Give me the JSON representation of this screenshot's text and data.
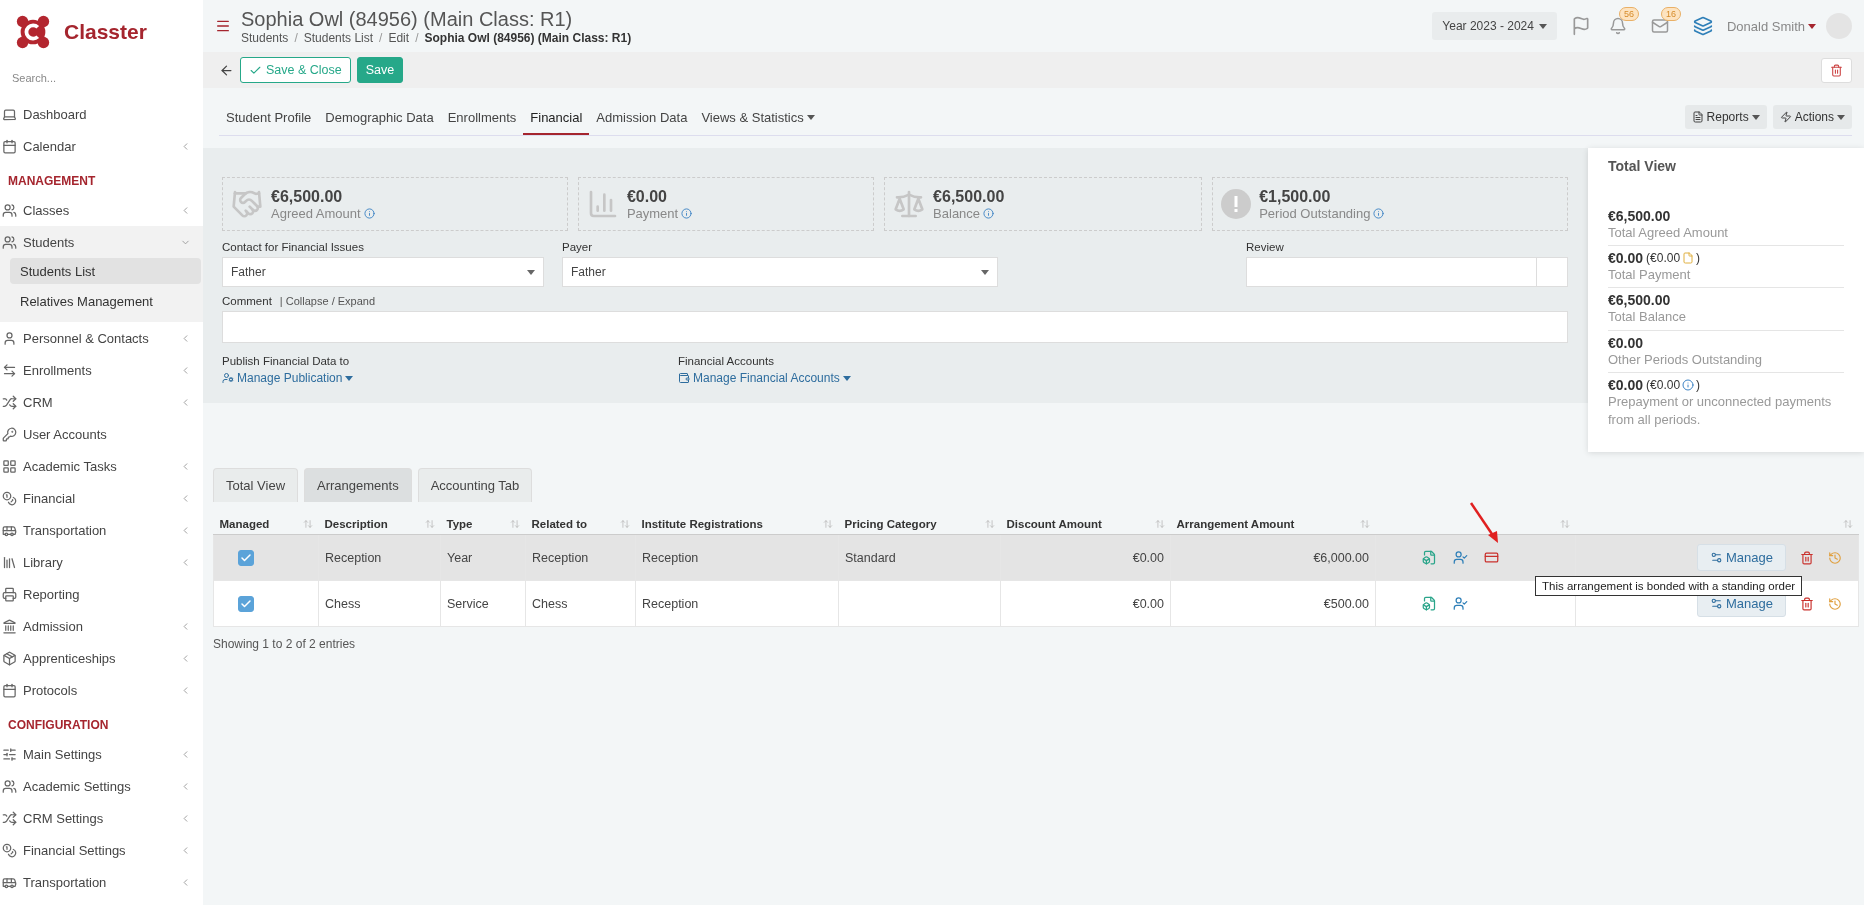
{
  "brand": {
    "name": "Classter"
  },
  "sidebar": {
    "search_placeholder": "Search...",
    "items": [
      {
        "kind": "item",
        "label": "Dashboard",
        "submenu": false,
        "expanded": false
      },
      {
        "kind": "item",
        "label": "Calendar",
        "submenu": true,
        "expanded": false
      },
      {
        "kind": "header",
        "label": "MANAGEMENT"
      },
      {
        "kind": "item",
        "label": "Classes",
        "submenu": true,
        "expanded": false
      },
      {
        "kind": "item",
        "label": "Students",
        "submenu": true,
        "expanded": true,
        "children": [
          {
            "label": "Students List",
            "selected": true
          },
          {
            "label": "Relatives Management",
            "selected": false
          }
        ]
      },
      {
        "kind": "item",
        "label": "Personnel & Contacts",
        "submenu": true,
        "expanded": false
      },
      {
        "kind": "item",
        "label": "Enrollments",
        "submenu": true,
        "expanded": false
      },
      {
        "kind": "item",
        "label": "CRM",
        "submenu": true,
        "expanded": false
      },
      {
        "kind": "item",
        "label": "User Accounts",
        "submenu": false,
        "expanded": false
      },
      {
        "kind": "item",
        "label": "Academic Tasks",
        "submenu": true,
        "expanded": false
      },
      {
        "kind": "item",
        "label": "Financial",
        "submenu": true,
        "expanded": false
      },
      {
        "kind": "item",
        "label": "Transportation",
        "submenu": true,
        "expanded": false
      },
      {
        "kind": "item",
        "label": "Library",
        "submenu": true,
        "expanded": false
      },
      {
        "kind": "item",
        "label": "Reporting",
        "submenu": false,
        "expanded": false
      },
      {
        "kind": "item",
        "label": "Admission",
        "submenu": true,
        "expanded": false
      },
      {
        "kind": "item",
        "label": "Apprenticeships",
        "submenu": true,
        "expanded": false
      },
      {
        "kind": "item",
        "label": "Protocols",
        "submenu": true,
        "expanded": false
      },
      {
        "kind": "header",
        "label": "CONFIGURATION"
      },
      {
        "kind": "item",
        "label": "Main Settings",
        "submenu": true,
        "expanded": false
      },
      {
        "kind": "item",
        "label": "Academic Settings",
        "submenu": true,
        "expanded": false
      },
      {
        "kind": "item",
        "label": "CRM Settings",
        "submenu": true,
        "expanded": false
      },
      {
        "kind": "item",
        "label": "Financial Settings",
        "submenu": true,
        "expanded": false
      },
      {
        "kind": "item",
        "label": "Transportation",
        "submenu": true,
        "expanded": false
      }
    ]
  },
  "header": {
    "title": "Sophia Owl (84956) (Main Class: R1)",
    "breadcrumbs": [
      "Students",
      "Students List",
      "Edit",
      "Sophia Owl (84956) (Main Class: R1)"
    ],
    "separator": "/",
    "year": "Year 2023 - 2024",
    "notifications": "56",
    "messages": "16",
    "user": "Donald Smith"
  },
  "toolbar": {
    "save_close": "Save & Close",
    "save": "Save"
  },
  "tabs": [
    {
      "label": "Student Profile",
      "selected": false,
      "dropdown": false
    },
    {
      "label": "Demographic Data",
      "selected": false,
      "dropdown": false
    },
    {
      "label": "Enrollments",
      "selected": false,
      "dropdown": false
    },
    {
      "label": "Financial",
      "selected": true,
      "dropdown": false
    },
    {
      "label": "Admission Data",
      "selected": false,
      "dropdown": false
    },
    {
      "label": "Views & Statistics",
      "selected": false,
      "dropdown": true
    }
  ],
  "tab_actions": [
    "Reports",
    "Actions"
  ],
  "summary": [
    {
      "amount": "€6,500.00",
      "label": "Agreed Amount"
    },
    {
      "amount": "€0.00",
      "label": "Payment"
    },
    {
      "amount": "€6,500.00",
      "label": "Balance"
    },
    {
      "amount": "€1,500.00",
      "label": "Period Outstanding"
    }
  ],
  "form": {
    "contact_label": "Contact for Financial Issues",
    "contact_value": "Father",
    "payer_label": "Payer",
    "payer_value": "Father",
    "review_label": "Review",
    "comment_label": "Comment",
    "comment_toggle": "| Collapse / Expand",
    "publish_label": "Publish Financial Data to",
    "publish_link": "Manage Publication",
    "accounts_label": "Financial Accounts",
    "accounts_link": "Manage Financial Accounts"
  },
  "total_view": {
    "title": "Total View",
    "entries": [
      {
        "kind": "plain",
        "value": "€6,500.00",
        "label": "Total Agreed Amount"
      },
      {
        "kind": "file_note",
        "value": "€0.00",
        "extra_open": "(€0.00",
        "extra_close": ")",
        "label": "Total Payment"
      },
      {
        "kind": "plain",
        "value": "€6,500.00",
        "label": "Total Balance"
      },
      {
        "kind": "plain",
        "value": "€0.00",
        "label": "Other Periods Outstanding"
      },
      {
        "kind": "info_note",
        "value": "€0.00",
        "extra_open": "(€0.00",
        "extra_close": ")",
        "label": "Prepayment or unconnected payments from all periods."
      }
    ]
  },
  "section_tabs": [
    {
      "label": "Total View",
      "selected": false
    },
    {
      "label": "Arrangements",
      "selected": true
    },
    {
      "label": "Accounting Tab",
      "selected": false
    }
  ],
  "table": {
    "columns": [
      "Managed",
      "Description",
      "Type",
      "Related to",
      "Institute Registrations",
      "Pricing Category",
      "Discount Amount",
      "Arrangement Amount"
    ],
    "rows": [
      {
        "managed": true,
        "highlighted": true,
        "bonded": true,
        "cells": [
          "",
          "Reception",
          "Year",
          "Reception",
          "Reception",
          "Standard",
          "€0.00",
          "€6,000.00"
        ],
        "action": "Manage"
      },
      {
        "managed": true,
        "highlighted": false,
        "bonded": false,
        "cells": [
          "",
          "Chess",
          "Service",
          "Chess",
          "Reception",
          "",
          "€0.00",
          "€500.00"
        ],
        "action": "Manage"
      }
    ],
    "footer": "Showing 1 to 2 of 2 entries"
  },
  "tooltip": "This arrangement is bonded with a standing order"
}
